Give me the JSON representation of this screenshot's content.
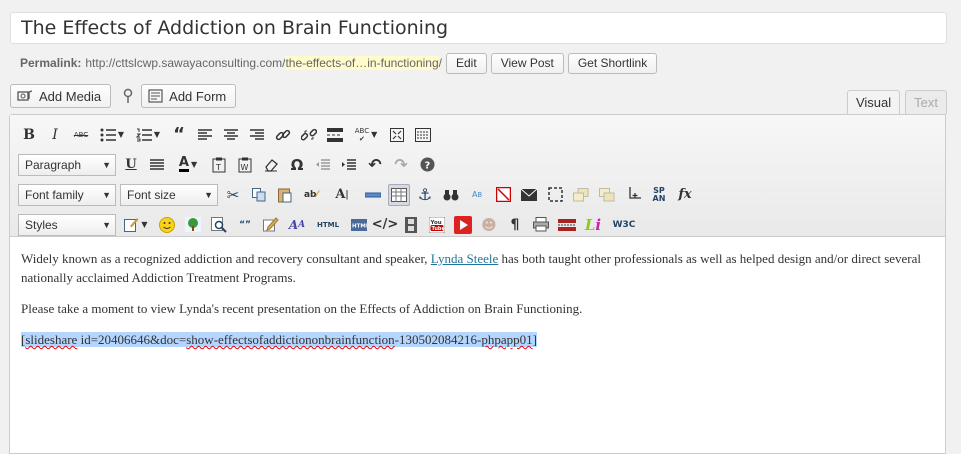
{
  "post": {
    "title": "The Effects of Addiction on Brain Functioning"
  },
  "permalink": {
    "label": "Permalink:",
    "base": "http://cttslcwp.sawayaconsulting.com/",
    "slug": "the-effects-of…in-functioning",
    "trail": "/",
    "buttons": {
      "edit": "Edit",
      "view_post": "View Post",
      "get_shortlink": "Get Shortlink"
    }
  },
  "media": {
    "add_media": "Add Media",
    "add_form": "Add Form"
  },
  "tabs": {
    "visual": "Visual",
    "text": "Text"
  },
  "toolbar": {
    "format_select": "Paragraph",
    "font_family": "Font family",
    "font_size": "Font size",
    "styles": "Styles",
    "bold": "B",
    "italic": "I",
    "strike": "ABC",
    "spell": "ABC",
    "html": "HTML",
    "span": "SP\nAN",
    "fx": "fx",
    "w3c": "W3C",
    "li": "Li"
  },
  "content": {
    "para1_before": "Widely known as a recognized addiction and recovery consultant and speaker, ",
    "para1_link": "Lynda Steele",
    "para1_after": " has both taught other professionals as well as helped design and/or direct several nationally acclaimed Addiction Treatment Programs.",
    "para2": "Please take a moment to view Lynda's recent presentation on the Effects of Addiction on Brain Functioning.",
    "shortcode_open": "[",
    "shortcode_tag": "slideshare",
    "shortcode_mid": " id=20406646&doc=",
    "shortcode_doc": "show-effectsofaddictiononbrainfunction",
    "shortcode_tail": "-130502084216-",
    "shortcode_app": "phpapp01",
    "shortcode_close": "]"
  },
  "colors": {
    "link": "#21759b",
    "slug_highlight": "#fffbcc",
    "selection": "#b4d5fe"
  }
}
